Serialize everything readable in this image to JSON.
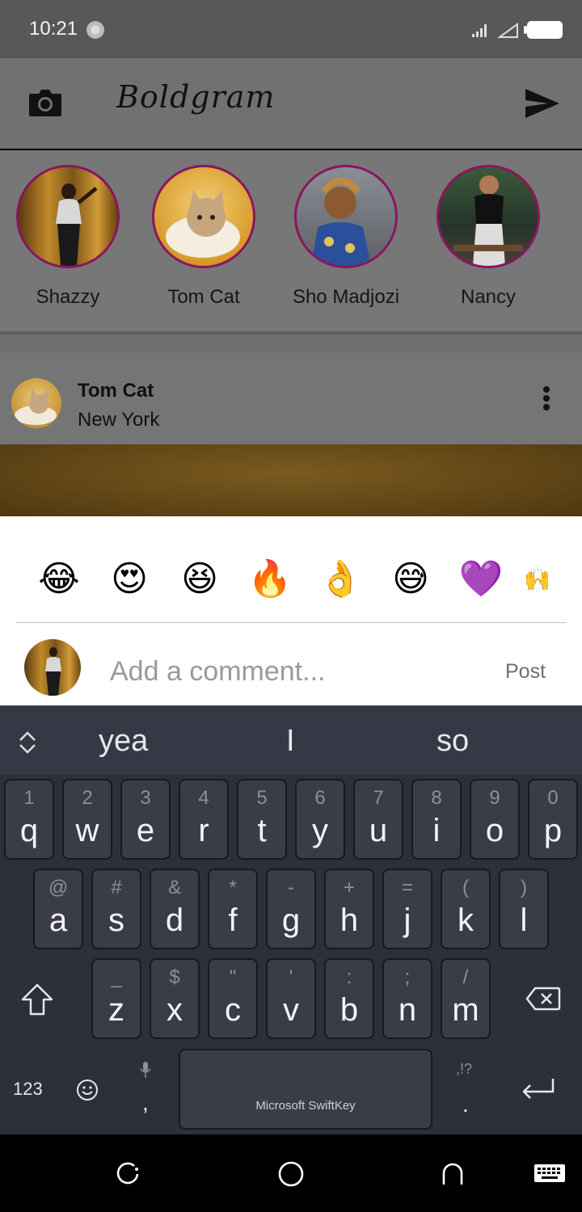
{
  "status_bar": {
    "time": "10:21"
  },
  "app": {
    "title": "Boldgram"
  },
  "stories": [
    {
      "name": "Shazzy"
    },
    {
      "name": "Tom Cat"
    },
    {
      "name": "Sho Madjozi"
    },
    {
      "name": "Nancy"
    }
  ],
  "post": {
    "user": "Tom Cat",
    "location": "New York"
  },
  "emojis": [
    "😂",
    "😍",
    "😆",
    "🔥",
    "👌",
    "😅",
    "💜",
    "🙌"
  ],
  "comment": {
    "placeholder": "Add a comment...",
    "post_label": "Post"
  },
  "keyboard": {
    "suggestions": [
      "yea",
      "I",
      "so"
    ],
    "row1": [
      {
        "hint": "1",
        "key": "q"
      },
      {
        "hint": "2",
        "key": "w"
      },
      {
        "hint": "3",
        "key": "e"
      },
      {
        "hint": "4",
        "key": "r"
      },
      {
        "hint": "5",
        "key": "t"
      },
      {
        "hint": "6",
        "key": "y"
      },
      {
        "hint": "7",
        "key": "u"
      },
      {
        "hint": "8",
        "key": "i"
      },
      {
        "hint": "9",
        "key": "o"
      },
      {
        "hint": "0",
        "key": "p"
      }
    ],
    "row2": [
      {
        "hint": "@",
        "key": "a"
      },
      {
        "hint": "#",
        "key": "s"
      },
      {
        "hint": "&",
        "key": "d"
      },
      {
        "hint": "*",
        "key": "f"
      },
      {
        "hint": "-",
        "key": "g"
      },
      {
        "hint": "+",
        "key": "h"
      },
      {
        "hint": "=",
        "key": "j"
      },
      {
        "hint": "(",
        "key": "k"
      },
      {
        "hint": ")",
        "key": "l"
      }
    ],
    "row3": [
      {
        "hint": "_",
        "key": "z"
      },
      {
        "hint": "$",
        "key": "x"
      },
      {
        "hint": "\"",
        "key": "c"
      },
      {
        "hint": "'",
        "key": "v"
      },
      {
        "hint": ":",
        "key": "b"
      },
      {
        "hint": ";",
        "key": "n"
      },
      {
        "hint": "/",
        "key": "m"
      }
    ],
    "numbers_label": "123",
    "comma_label": ",",
    "period_label": ".",
    "punct_hint": ",!?",
    "space_label": "Microsoft SwiftKey"
  },
  "colors": {
    "story_ring": "#8a1560",
    "keyboard_bg": "#2d2f3b"
  }
}
